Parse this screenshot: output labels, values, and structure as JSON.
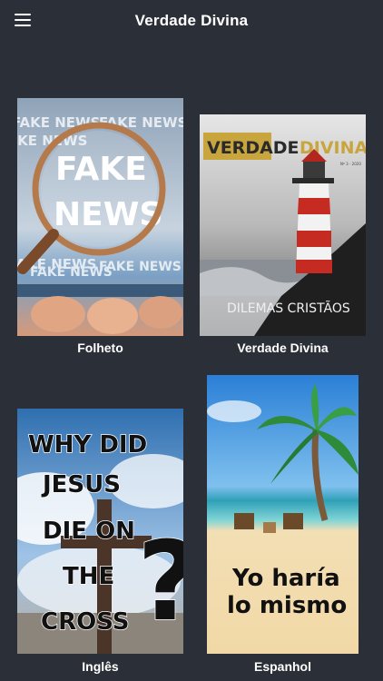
{
  "header": {
    "title": "Verdade Divina",
    "menu_icon": "hamburger-menu-icon"
  },
  "items": [
    {
      "caption": "Folheto",
      "cover": {
        "words": [
          "FAKE NEWS",
          "FAKE",
          "NEWS"
        ],
        "icon": "magnifying-glass-icon"
      }
    },
    {
      "caption": "Verdade Divina",
      "cover": {
        "masthead_left": "VERDADE",
        "masthead_right": "DIVINA",
        "issue": "Nº 3 - 2020",
        "subtitle": "DILEMAS CRISTÃOS",
        "icon": "lighthouse-icon"
      }
    },
    {
      "caption": "Inglês",
      "cover": {
        "lines": [
          "WHY DID",
          "JESUS",
          "DIE ON",
          "THE",
          "CROSS"
        ],
        "question_mark": "?",
        "icon": "cross-icon"
      }
    },
    {
      "caption": "Espanhol",
      "cover": {
        "lines": [
          "Yo haría",
          "lo mismo"
        ],
        "icon": "palm-tree-icon"
      }
    }
  ],
  "colors": {
    "background": "#2b2f37",
    "text": "#ffffff",
    "masthead": "#c9a53d"
  }
}
